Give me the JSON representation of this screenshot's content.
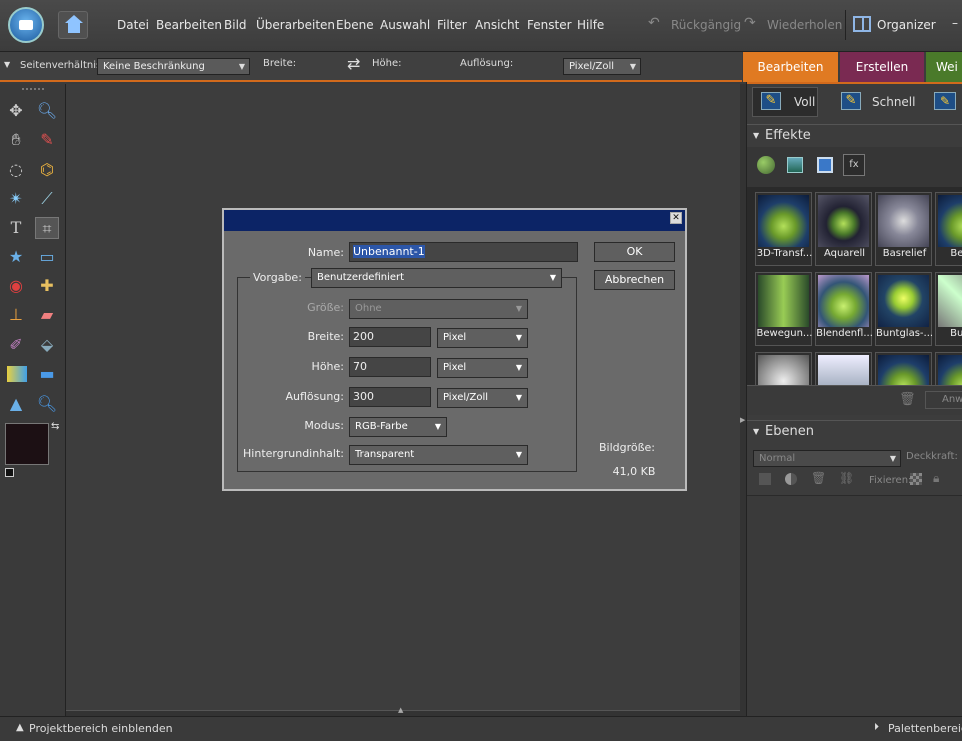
{
  "menubar": {
    "items": [
      "Datei",
      "Bearbeiten",
      "Bild",
      "Überarbeiten",
      "Ebene",
      "Auswahl",
      "Filter",
      "Ansicht",
      "Fenster",
      "Hilfe"
    ],
    "undo": "Rückgängig",
    "redo": "Wiederholen",
    "organizer": "Organizer"
  },
  "options": {
    "aspect_label": "Seitenverhältnis:",
    "aspect_value": "Keine Beschränkung",
    "width_label": "Breite:",
    "height_label": "Höhe:",
    "resolution_label": "Auflösung:",
    "resolution_unit": "Pixel/Zoll"
  },
  "tabs": {
    "edit": "Bearbeiten",
    "create": "Erstellen",
    "share": "Wei"
  },
  "modes": {
    "full": "Voll",
    "quick": "Schnell"
  },
  "effects": {
    "title": "Effekte",
    "thumbs": [
      "3D-Transf...",
      "Aquarell",
      "Basrelief",
      "Beleu",
      "Bewegun...",
      "Blendenfl...",
      "Buntglas-...",
      "Bunts"
    ],
    "apply": "Anw"
  },
  "layers": {
    "title": "Ebenen",
    "blend": "Normal",
    "opacity_label": "Deckkraft:",
    "lock_label": "Fixieren:"
  },
  "dialog": {
    "name_label": "Name:",
    "name_value": "Unbenannt-1",
    "preset_label": "Vorgabe:",
    "preset_value": "Benutzerdefiniert",
    "size_label": "Größe:",
    "size_value": "Ohne",
    "width_label": "Breite:",
    "width_value": "200",
    "width_unit": "Pixel",
    "height_label": "Höhe:",
    "height_value": "70",
    "height_unit": "Pixel",
    "res_label": "Auflösung:",
    "res_value": "300",
    "res_unit": "Pixel/Zoll",
    "mode_label": "Modus:",
    "mode_value": "RGB-Farbe",
    "bg_label": "Hintergrundinhalt:",
    "bg_value": "Transparent",
    "ok": "OK",
    "cancel": "Abbrechen",
    "image_size_label": "Bildgröße:",
    "image_size_value": "41,0 KB"
  },
  "status": {
    "project": "Projektbereich einblenden",
    "palette": "Palettenbereich"
  },
  "colors": {
    "accent": "#d26a1c",
    "create_tab": "#7a2a52",
    "share_tab": "#4a7a2a",
    "foreground": "#1c1014",
    "dialog_title": "#0c2466"
  }
}
